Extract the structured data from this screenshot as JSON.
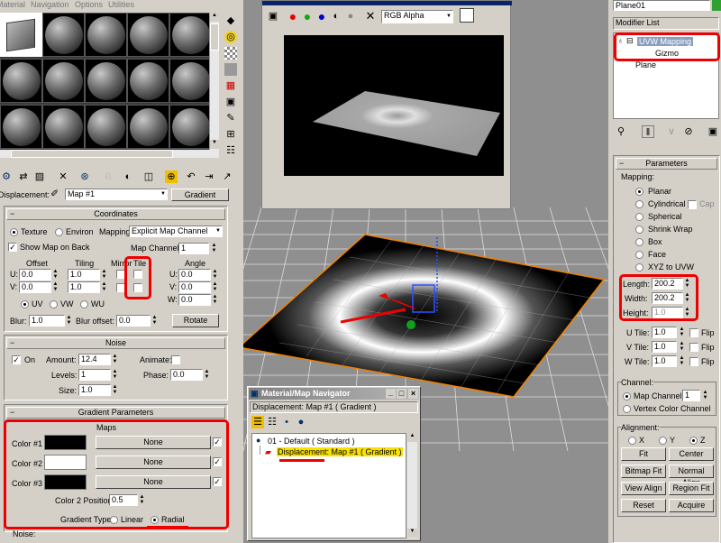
{
  "menu": [
    "Material",
    "Navigation",
    "Options",
    "Utilities"
  ],
  "material_editor": {
    "displacement_label": "Displacement:",
    "map_name": "Map #1",
    "map_type": "Gradient"
  },
  "coordinates": {
    "title": "Coordinates",
    "texture": "Texture",
    "environ": "Environ",
    "mapping_label": "Mapping:",
    "mapping_value": "Explicit Map Channel",
    "show_map_on_back": "Show Map on Back",
    "map_channel_label": "Map Channel:",
    "map_channel": "1",
    "offset": "Offset",
    "tiling": "Tiling",
    "mirror": "Mirror",
    "tile": "Tile",
    "angle": "Angle",
    "u": "U:",
    "v": "V:",
    "w": "W:",
    "u_offset": "0.0",
    "v_offset": "0.0",
    "u_tiling": "1.0",
    "v_tiling": "1.0",
    "u_angle": "0.0",
    "v_angle": "0.0",
    "w_angle": "0.0",
    "uv": "UV",
    "vw": "VW",
    "wu": "WU",
    "blur_label": "Blur:",
    "blur": "1.0",
    "blur_offset_label": "Blur offset:",
    "blur_offset": "0.0",
    "rotate": "Rotate"
  },
  "noise": {
    "title": "Noise",
    "on": "On",
    "amount_label": "Amount:",
    "amount": "12.4",
    "animate": "Animate:",
    "levels_label": "Levels:",
    "levels": "1",
    "phase_label": "Phase:",
    "phase": "0.0",
    "size_label": "Size:",
    "size": "1.0"
  },
  "gradient": {
    "title": "Gradient Parameters",
    "maps": "Maps",
    "color1": "Color #1",
    "color2": "Color #2",
    "color3": "Color #3",
    "none": "None",
    "color2_position_label": "Color 2 Position:",
    "color2_position": "0.5",
    "type_label": "Gradient Type:",
    "linear": "Linear",
    "radial": "Radial",
    "colors": [
      "#000000",
      "#ffffff",
      "#000000"
    ]
  },
  "noise_next": "Noise:",
  "render_window": {
    "channel": "RGB Alpha"
  },
  "navigator": {
    "title": "Material/Map Navigator",
    "path": "Displacement: Map #1  ( Gradient )",
    "item1": "01 - Default  ( Standard )",
    "item2": "Displacement: Map #1  ( Gradient )"
  },
  "modifier_panel": {
    "object_name": "Plane01",
    "modifier_list": "Modifier List",
    "stack": [
      "UVW Mapping",
      "Gizmo",
      "Plane"
    ],
    "parameters": "Parameters",
    "mapping": "Mapping:",
    "mapping_types": [
      "Planar",
      "Cylindrical",
      "Spherical",
      "Shrink Wrap",
      "Box",
      "Face",
      "XYZ to UVW"
    ],
    "cap": "Cap",
    "length_label": "Length:",
    "length": "200.2",
    "width_label": "Width:",
    "width": "200.2",
    "height_label": "Height:",
    "height": "1.0",
    "u_tile_label": "U Tile:",
    "v_tile_label": "V Tile:",
    "w_tile_label": "W Tile:",
    "u_tile": "1.0",
    "v_tile": "1.0",
    "w_tile": "1.0",
    "flip": "Flip",
    "channel": "Channel:",
    "map_channel": "Map Channel:",
    "map_channel_value": "1",
    "vertex_color_channel": "Vertex Color Channel",
    "alignment": "Alignment:",
    "x": "X",
    "y": "Y",
    "z": "Z",
    "buttons": [
      "Fit",
      "Center",
      "Bitmap Fit",
      "Normal Align",
      "View Align",
      "Region Fit",
      "Reset",
      "Acquire"
    ]
  },
  "accent": "#e00000"
}
